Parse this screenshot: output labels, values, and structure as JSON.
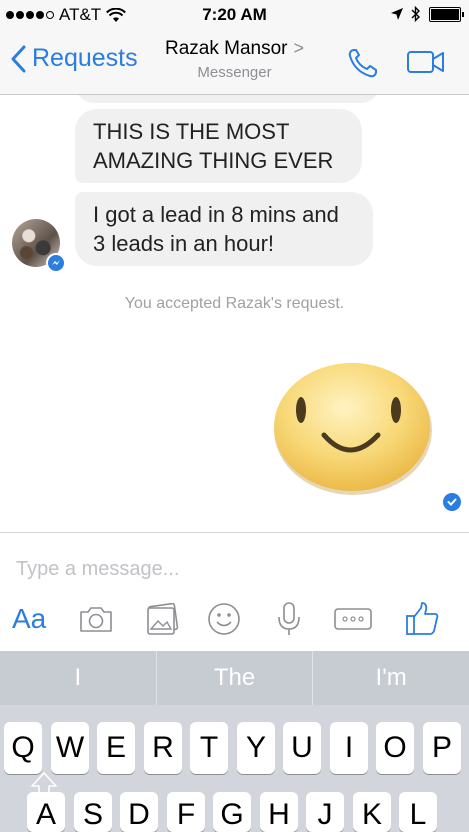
{
  "status_bar": {
    "carrier": "AT&T",
    "time": "7:20 AM"
  },
  "nav": {
    "back_label": "Requests",
    "title": "Razak Mansor",
    "title_chevron": ">",
    "subtitle": "Messenger"
  },
  "messages": [
    {
      "sender": "Razak Mansor",
      "text": "THIS IS THE MOST AMAZING THING EVER"
    },
    {
      "sender": "Razak Mansor",
      "text": "I got a lead in 8 mins and 3 leads in an hour!"
    }
  ],
  "system_note": "You accepted Razak's request.",
  "composer": {
    "placeholder": "Type a message...",
    "text_format_label": "Aa"
  },
  "keyboard": {
    "suggestions": [
      "I",
      "The",
      "I'm"
    ],
    "row1": [
      "Q",
      "W",
      "E",
      "R",
      "T",
      "Y",
      "U",
      "I",
      "O",
      "P"
    ],
    "row2": [
      "A",
      "S",
      "D",
      "F",
      "G",
      "H",
      "J",
      "K",
      "L"
    ]
  },
  "colors": {
    "accent": "#2a7de1",
    "bubble": "#f1f0f0",
    "bar": "#f7f7f8"
  },
  "icons": [
    "wifi-icon",
    "location-arrow-icon",
    "bluetooth-icon",
    "battery-icon",
    "back-chevron-icon",
    "phone-icon",
    "video-camera-icon",
    "messenger-badge-icon",
    "smiley-sticker",
    "seen-check-icon",
    "camera-icon",
    "gallery-icon",
    "emoji-icon",
    "microphone-icon",
    "more-icon",
    "thumbs-up-icon"
  ]
}
